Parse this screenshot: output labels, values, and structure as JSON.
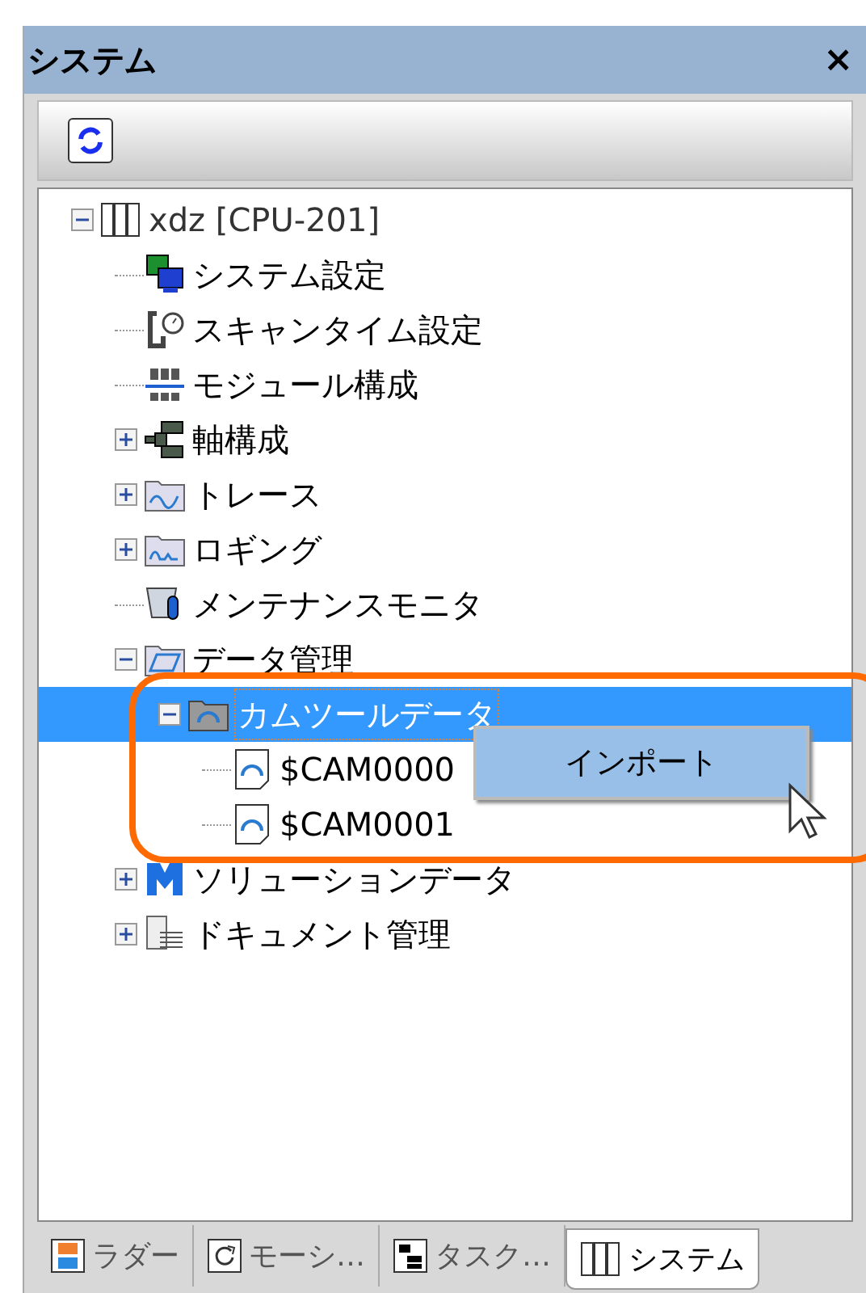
{
  "panel": {
    "title": "システム",
    "close": "×"
  },
  "tree": [
    {
      "label": "xdz [CPU-201]",
      "kind": "cpu",
      "expanded": true,
      "selected": false,
      "children": [
        {
          "label": "システム設定",
          "kind": "system",
          "selected": false
        },
        {
          "label": "スキャンタイム設定",
          "kind": "scan",
          "selected": false
        },
        {
          "label": "モジュール構成",
          "kind": "module",
          "selected": false
        },
        {
          "label": "軸構成",
          "kind": "axis",
          "expanded": false,
          "selected": false
        },
        {
          "label": "トレース",
          "kind": "trace",
          "expanded": false,
          "selected": false
        },
        {
          "label": "ロギング",
          "kind": "logging",
          "expanded": false,
          "selected": false
        },
        {
          "label": "メンテナンスモニタ",
          "kind": "maintenance",
          "selected": false
        },
        {
          "label": "データ管理",
          "kind": "data",
          "expanded": true,
          "selected": false,
          "children": [
            {
              "label": "カムツールデータ",
              "kind": "camfolder",
              "expanded": true,
              "selected": true,
              "children": [
                {
                  "label": "$CAM0000",
                  "kind": "camfile",
                  "selected": false
                },
                {
                  "label": "$CAM0001",
                  "kind": "camfile",
                  "selected": false
                }
              ]
            }
          ]
        },
        {
          "label": "ソリューションデータ",
          "kind": "solution",
          "expanded": false,
          "selected": false
        },
        {
          "label": "ドキュメント管理",
          "kind": "document",
          "expanded": false,
          "selected": false
        }
      ]
    }
  ],
  "context_menu": {
    "items": [
      "インポート"
    ]
  },
  "tabs": [
    {
      "label": "ラダー",
      "kind": "ladder",
      "selected": false
    },
    {
      "label": "モーシ…",
      "kind": "motion",
      "selected": false
    },
    {
      "label": "タスク…",
      "kind": "task",
      "selected": false
    },
    {
      "label": "システム",
      "kind": "cpu",
      "selected": true
    }
  ]
}
